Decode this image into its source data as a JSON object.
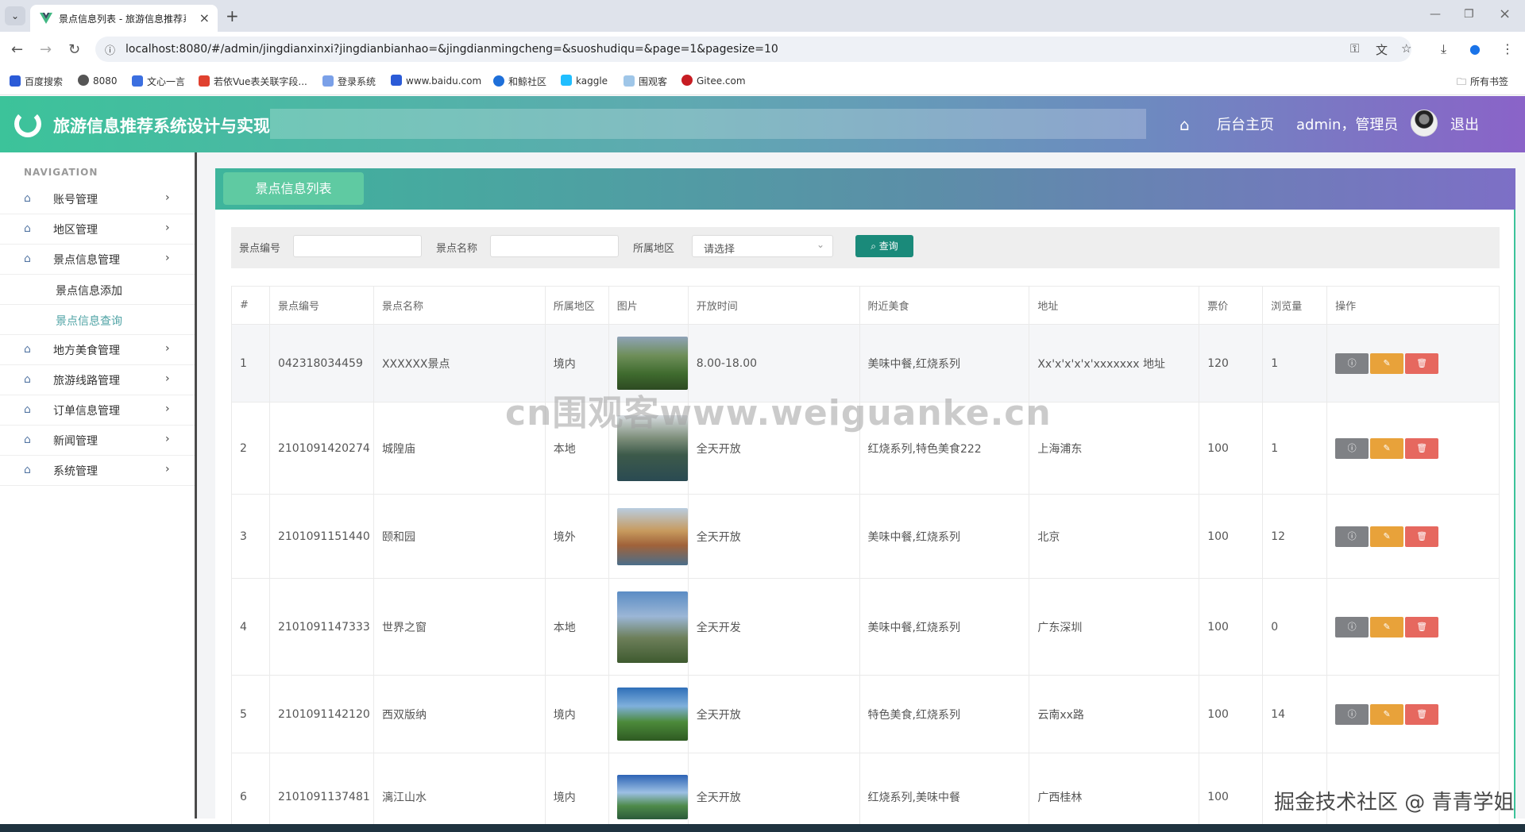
{
  "browser": {
    "tab_title": "景点信息列表 - 旅游信息推荐系",
    "url": "localhost:8080/#/admin/jingdianxinxi?jingdianbianhao=&jingdianmingcheng=&suoshudiqu=&page=1&pagesize=10",
    "bookmarks": [
      "百度搜索",
      "8080",
      "文心一言",
      "若依Vue表关联字段...",
      "登录系统",
      "www.baidu.com",
      "和鲸社区",
      "kaggle",
      "围观客",
      "Gitee.com"
    ],
    "all_bookmarks": "所有书签"
  },
  "header": {
    "title": "旅游信息推荐系统设计与实现",
    "home_link": "后台主页",
    "user": "admin，管理员",
    "logout": "退出"
  },
  "sidebar": {
    "heading": "NAVIGATION",
    "items": [
      {
        "label": "账号管理"
      },
      {
        "label": "地区管理"
      },
      {
        "label": "景点信息管理"
      },
      {
        "label": "地方美食管理"
      },
      {
        "label": "旅游线路管理"
      },
      {
        "label": "订单信息管理"
      },
      {
        "label": "新闻管理"
      },
      {
        "label": "系统管理"
      }
    ],
    "sub_items": [
      {
        "label": "景点信息添加"
      },
      {
        "label": "景点信息查询"
      }
    ]
  },
  "panel": {
    "title": "景点信息列表"
  },
  "filter": {
    "label_code": "景点编号",
    "label_name": "景点名称",
    "label_region": "所属地区",
    "region_placeholder": "请选择",
    "query": "查询"
  },
  "table": {
    "headers": [
      "#",
      "景点编号",
      "景点名称",
      "所属地区",
      "图片",
      "开放时间",
      "附近美食",
      "地址",
      "票价",
      "浏览量",
      "操作"
    ],
    "rows": [
      {
        "idx": "1",
        "code": "042318034459",
        "name": "XXXXXX景点",
        "region": "境内",
        "open": "8.00-18.00",
        "food": "美味中餐,红烧系列",
        "addr": "Xx'x'x'x'x'xxxxxxx 地址",
        "price": "120",
        "views": "1"
      },
      {
        "idx": "2",
        "code": "2101091420274",
        "name": "城隍庙",
        "region": "本地",
        "open": "全天开放",
        "food": "红烧系列,特色美食222",
        "addr": "上海浦东",
        "price": "100",
        "views": "1"
      },
      {
        "idx": "3",
        "code": "2101091151440",
        "name": "颐和园",
        "region": "境外",
        "open": "全天开放",
        "food": "美味中餐,红烧系列",
        "addr": "北京",
        "price": "100",
        "views": "12"
      },
      {
        "idx": "4",
        "code": "2101091147333",
        "name": "世界之窗",
        "region": "本地",
        "open": "全天开发",
        "food": "美味中餐,红烧系列",
        "addr": "广东深圳",
        "price": "100",
        "views": "0"
      },
      {
        "idx": "5",
        "code": "2101091142120",
        "name": "西双版纳",
        "region": "境内",
        "open": "全天开放",
        "food": "特色美食,红烧系列",
        "addr": "云南xx路",
        "price": "100",
        "views": "14"
      },
      {
        "idx": "6",
        "code": "2101091137481",
        "name": "漓江山水",
        "region": "境内",
        "open": "全天开放",
        "food": "红烧系列,美味中餐",
        "addr": "广西桂林",
        "price": "100",
        "views": ""
      }
    ]
  },
  "watermarks": {
    "center": "cn围观客www.weiguanke.cn",
    "corner": "掘金技术社区 @ 青青学姐"
  },
  "colors": {
    "accent": "#3cc39a",
    "query_btn": "#1a8a7a",
    "info_btn": "#7f8185",
    "edit_btn": "#e8a23a",
    "delete_btn": "#e6685f",
    "active_sub": "#4fa3a5"
  }
}
